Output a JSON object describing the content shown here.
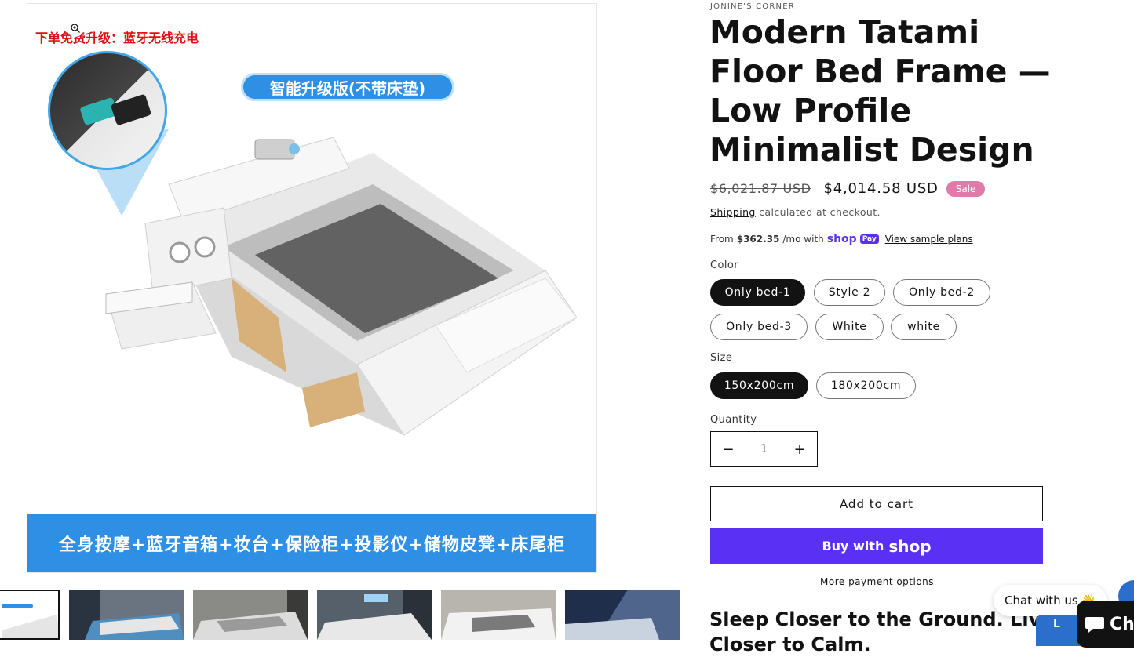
{
  "media": {
    "promo_top": "下单免费升级：蓝牙无线充电",
    "badge": "智能升级版(不带床垫)",
    "banner": "全身按摩+蓝牙音箱+妆台+保险柜+投影仪+储物皮凳+床尾柜"
  },
  "product": {
    "vendor": "JONINE'S CORNER",
    "title": "Modern Tatami Floor Bed Frame — Low Profile Minimalist Design",
    "price_old": "$6,021.87 USD",
    "price_new": "$4,014.58 USD",
    "sale_badge": "Sale",
    "shipping_link": "Shipping",
    "shipping_text": "calculated at checkout.",
    "installment_prefix": "From",
    "installment_amount": "$362.35",
    "installment_suffix": "/mo with",
    "shop_pay_word": "shop",
    "shop_pay_badge": "Pay",
    "view_plans": "View sample plans"
  },
  "options": {
    "color_label": "Color",
    "colors": [
      "Only bed-1",
      "Style 2",
      "Only bed-2",
      "Only bed-3",
      "White",
      "white"
    ],
    "size_label": "Size",
    "sizes": [
      "150x200cm",
      "180x200cm"
    ]
  },
  "quantity": {
    "label": "Quantity",
    "value": "1",
    "minus": "−",
    "plus": "+"
  },
  "actions": {
    "add_to_cart": "Add to cart",
    "buy_with": "Buy with",
    "buy_shop_word": "shop",
    "more_payment": "More payment options"
  },
  "description": {
    "heading": "Sleep Closer to the Ground. Live Closer to Calm."
  },
  "chat": {
    "bubble": "Chat with us",
    "emoji": "👋",
    "button": "Ch",
    "shopify_prefix": "L"
  },
  "colors": {
    "accent": "#5a31f4",
    "sale": "#e07aa8",
    "banner": "#2e8fe5"
  }
}
